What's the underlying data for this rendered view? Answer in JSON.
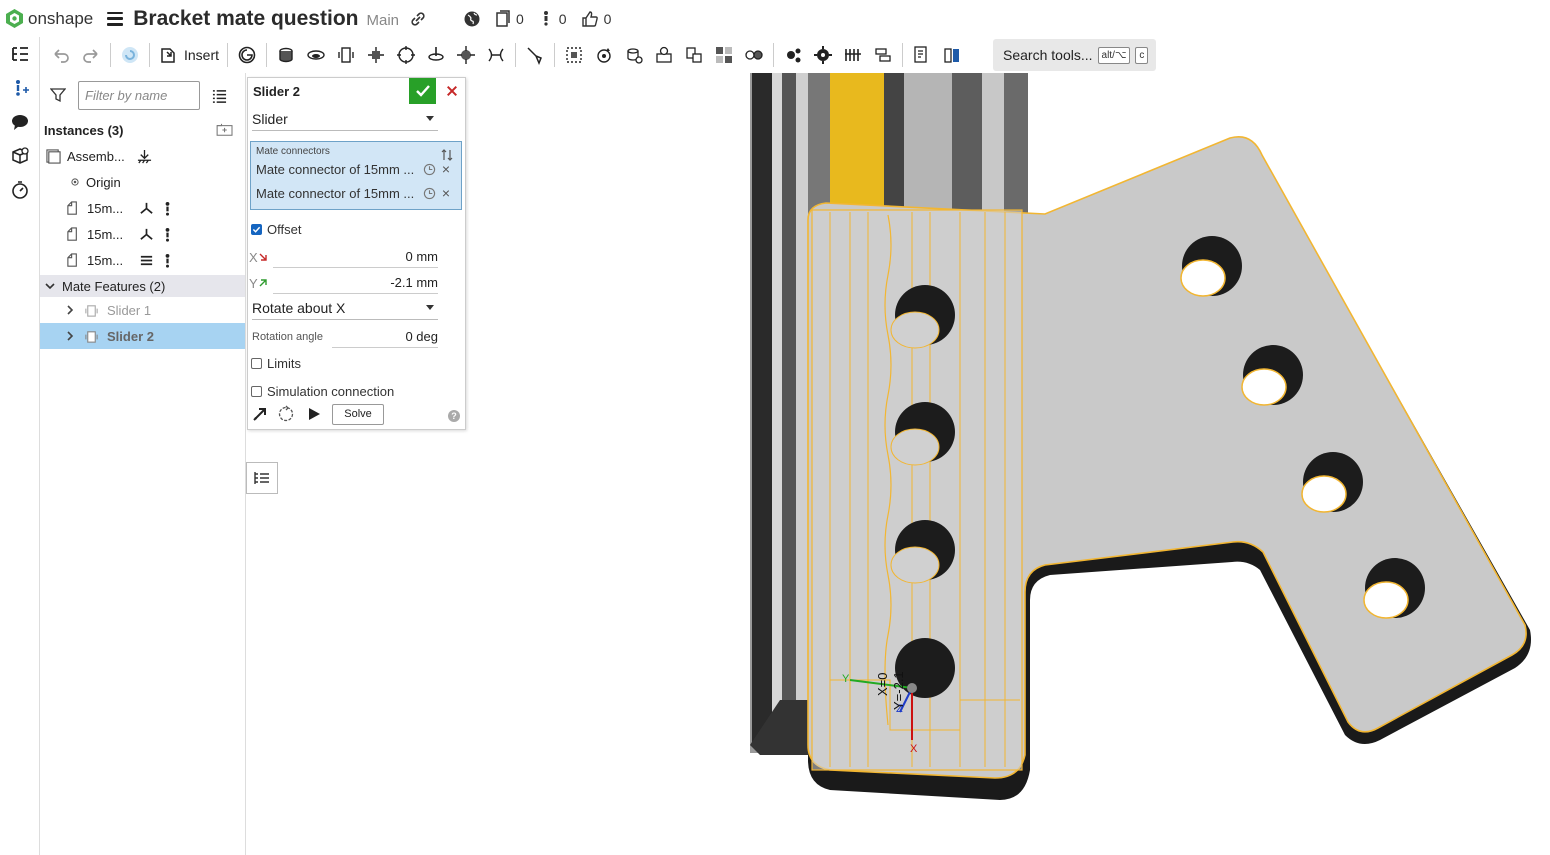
{
  "app": {
    "brand": "onshape"
  },
  "document": {
    "title": "Bracket mate question",
    "branch": "Main"
  },
  "counters": [
    {
      "icon": "versions-icon",
      "value": "0"
    },
    {
      "icon": "followers-icon",
      "value": "0"
    },
    {
      "icon": "likes-icon",
      "value": "0"
    }
  ],
  "toolbar": {
    "insert_label": "Insert",
    "search_label": "Search tools...",
    "search_kbd1": "alt/⌥",
    "search_kbd2": "c"
  },
  "feature_panel": {
    "filter_placeholder": "Filter by name",
    "instances_title": "Instances (3)",
    "instances": [
      {
        "label": "Assemb...",
        "kind": "assembly"
      },
      {
        "label": "Origin",
        "kind": "origin"
      },
      {
        "label": "15m...",
        "kind": "part"
      },
      {
        "label": "15m...",
        "kind": "part"
      },
      {
        "label": "15m...",
        "kind": "part"
      }
    ],
    "mate_features_title": "Mate Features (2)",
    "mates": [
      {
        "label": "Slider 1",
        "selected": false
      },
      {
        "label": "Slider 2",
        "selected": true
      }
    ]
  },
  "dialog": {
    "title": "Slider 2",
    "mate_type": "Slider",
    "mate_connectors_label": "Mate connectors",
    "mate_connectors": [
      "Mate connector of 15mm ...",
      "Mate connector of 15mm ..."
    ],
    "offset_label": "Offset",
    "offset_checked": true,
    "x_label": "X",
    "x_value": "0 mm",
    "y_label": "Y",
    "y_value": "-2.1 mm",
    "rotate_option": "Rotate about X",
    "rotation_angle_label": "Rotation angle",
    "rotation_angle_value": "0 deg",
    "limits_label": "Limits",
    "simulation_label": "Simulation connection",
    "solve_label": "Solve"
  },
  "viewport": {
    "triad_labels": {
      "x": "X",
      "y": "Y",
      "z": "Z"
    },
    "offset_readout": {
      "x": "X=0",
      "y": "Y=-2.1"
    }
  },
  "colors": {
    "accent_green": "#28a028",
    "cancel_red": "#c62828",
    "selection_blue": "#a7d3f2",
    "highlight_orange": "#f2b632",
    "extrusion_yellow": "#e8b91e",
    "part_gray": "#c8c8c8"
  }
}
